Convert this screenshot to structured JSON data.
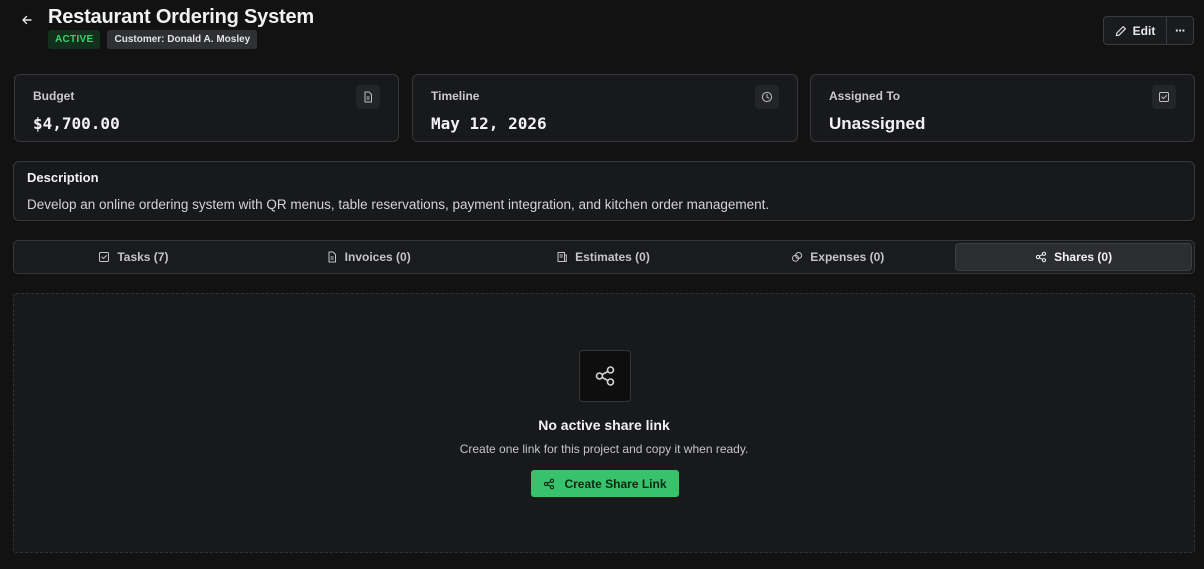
{
  "header": {
    "title": "Restaurant Ordering System",
    "status": "ACTIVE",
    "customer": "Customer: Donald A. Mosley",
    "edit_label": "Edit",
    "more_label": "···"
  },
  "cards": {
    "budget": {
      "label": "Budget",
      "value": "$4,700.00",
      "icon": "document-icon"
    },
    "timeline": {
      "label": "Timeline",
      "value": "May 12, 2026",
      "icon": "clock-icon"
    },
    "assigned": {
      "label": "Assigned To",
      "value": "Unassigned",
      "icon": "checkbox-icon"
    }
  },
  "description": {
    "title": "Description",
    "text": "Develop an online ordering system with QR menus, table reservations, payment integration, and kitchen order management."
  },
  "tabs": [
    {
      "label": "Tasks (7)",
      "icon": "checkbox-icon"
    },
    {
      "label": "Invoices (0)",
      "icon": "document-icon"
    },
    {
      "label": "Estimates (0)",
      "icon": "receipt-icon"
    },
    {
      "label": "Expenses (0)",
      "icon": "coins-icon"
    },
    {
      "label": "Shares (0)",
      "icon": "share-icon",
      "active": true
    }
  ],
  "shares": {
    "empty_title": "No active share link",
    "empty_subtitle": "Create one link for this project and copy it when ready.",
    "create_label": "Create Share Link"
  },
  "colors": {
    "background": "#121213",
    "card": "#18191b",
    "border": "#36373b",
    "accent_green": "#37c26b",
    "status_green": "#34d36b"
  }
}
